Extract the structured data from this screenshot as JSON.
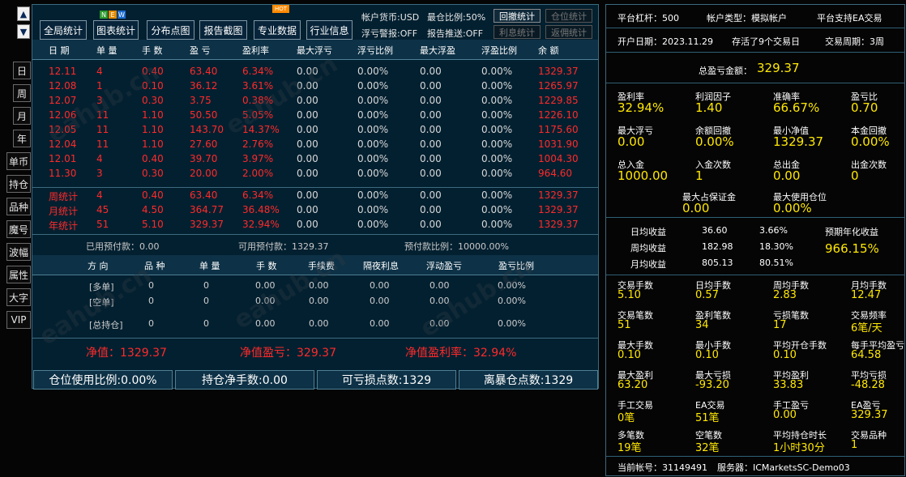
{
  "sidebar": {
    "up_glyph": "▲",
    "down_glyph": "▼",
    "items": [
      "日",
      "周",
      "月",
      "年",
      "单币",
      "持仓",
      "品种",
      "魔号",
      "波幅",
      "属性",
      "大字",
      "VIP"
    ]
  },
  "toolbar": {
    "buttons": [
      "全局统计",
      "图表统计",
      "分布点图",
      "报告截图",
      "专业数据",
      "行业信息"
    ],
    "new_badge": [
      "N",
      "E",
      "W"
    ],
    "hot_badge": "HOT",
    "info": {
      "currency": "帐户货币:USD",
      "max_ratio": "最仓比例:50%",
      "float_alert": "浮亏警报:OFF",
      "report_push": "报告推送:OFF"
    },
    "small_buttons": [
      "回撤统计",
      "仓位统计",
      "利息统计",
      "返佣统计"
    ]
  },
  "table": {
    "headers": [
      "日 期",
      "单 量",
      "手 数",
      "盈 亏",
      "盈利率",
      "最大浮亏",
      "浮亏比例",
      "最大浮盈",
      "浮盈比例",
      "余 额"
    ],
    "rows": [
      [
        "12.11",
        "4",
        "0.40",
        "63.40",
        "6.34%",
        "0.00",
        "0.00%",
        "0.00",
        "0.00%",
        "1329.37"
      ],
      [
        "12.08",
        "1",
        "0.10",
        "36.12",
        "3.61%",
        "0.00",
        "0.00%",
        "0.00",
        "0.00%",
        "1265.97"
      ],
      [
        "12.07",
        "3",
        "0.30",
        "3.75",
        "0.38%",
        "0.00",
        "0.00%",
        "0.00",
        "0.00%",
        "1229.85"
      ],
      [
        "12.06",
        "11",
        "1.10",
        "50.50",
        "5.05%",
        "0.00",
        "0.00%",
        "0.00",
        "0.00%",
        "1226.10"
      ],
      [
        "12.05",
        "11",
        "1.10",
        "143.70",
        "14.37%",
        "0.00",
        "0.00%",
        "0.00",
        "0.00%",
        "1175.60"
      ],
      [
        "12.04",
        "11",
        "1.10",
        "27.60",
        "2.76%",
        "0.00",
        "0.00%",
        "0.00",
        "0.00%",
        "1031.90"
      ],
      [
        "12.01",
        "4",
        "0.40",
        "39.70",
        "3.97%",
        "0.00",
        "0.00%",
        "0.00",
        "0.00%",
        "1004.30"
      ],
      [
        "11.30",
        "3",
        "0.30",
        "20.00",
        "2.00%",
        "0.00",
        "0.00%",
        "0.00",
        "0.00%",
        "964.60"
      ]
    ],
    "summary": [
      [
        "周统计",
        "4",
        "0.40",
        "63.40",
        "6.34%",
        "0.00",
        "0.00%",
        "0.00",
        "0.00%",
        "1329.37"
      ],
      [
        "月统计",
        "45",
        "4.50",
        "364.77",
        "36.48%",
        "0.00",
        "0.00%",
        "0.00",
        "0.00%",
        "1329.37"
      ],
      [
        "年统计",
        "51",
        "5.10",
        "329.37",
        "32.94%",
        "0.00",
        "0.00%",
        "0.00",
        "0.00%",
        "1329.37"
      ]
    ]
  },
  "prepay": {
    "used": "已用预付款：0.00",
    "available": "可用预付款：1329.37",
    "ratio": "预付款比例：10000.00%"
  },
  "positions": {
    "headers": [
      "方 向",
      "品 种",
      "单 量",
      "手 数",
      "手续费",
      "隔夜利息",
      "浮动盈亏",
      "盈亏比例"
    ],
    "rows": [
      [
        "[多单]",
        "0",
        "0",
        "0.00",
        "0.00",
        "0.00",
        "0.00",
        "0.00%"
      ],
      [
        "[空单]",
        "0",
        "0",
        "0.00",
        "0.00",
        "0.00",
        "0.00",
        "0.00%"
      ],
      [
        "[总持仓]",
        "0",
        "0",
        "0.00",
        "0.00",
        "0.00",
        "0.00",
        "0.00%"
      ]
    ]
  },
  "net": {
    "equity": "净值：1329.37",
    "equity_pnl": "净值盈亏：329.37",
    "equity_rate": "净值盈利率：32.94%"
  },
  "bottom_bar": [
    "仓位使用比例:0.00%",
    "持仓净手数:0.00",
    "可亏损点数:1329",
    "离暴仓点数:1329"
  ],
  "watermark": "eahub.cn",
  "right": {
    "leverage": "平台杠杆：500",
    "account_type": "帐户类型：模拟帐户",
    "ea_support": "平台支持EA交易",
    "open_date": "开户日期：2023.11.29",
    "survived": "存活了9个交易日",
    "cycle": "交易周期：3周",
    "total_pnl_label": "总盈亏金额：",
    "total_pnl_value": "329.37",
    "stats_a": [
      {
        "label": "盈利率",
        "value": "32.94%"
      },
      {
        "label": "利润因子",
        "value": "1.40"
      },
      {
        "label": "准确率",
        "value": "66.67%"
      },
      {
        "label": "盈亏比",
        "value": "0.70"
      },
      {
        "label": "最大浮亏",
        "value": "0.00"
      },
      {
        "label": "余额回撤",
        "value": "0.00%"
      },
      {
        "label": "最小净值",
        "value": "1329.37"
      },
      {
        "label": "本金回撤",
        "value": "0.00%"
      },
      {
        "label": "总入金",
        "value": "1000.00"
      },
      {
        "label": "入金次数",
        "value": "1"
      },
      {
        "label": "总出金",
        "value": "0.00"
      },
      {
        "label": "出金次数",
        "value": "0"
      }
    ],
    "margin": [
      {
        "label": "最大占保证金",
        "value": "0.00"
      },
      {
        "label": "最大使用仓位",
        "value": "0.00%"
      }
    ],
    "period": [
      {
        "label": "日均收益",
        "value": "36.60",
        "pct": "3.66%"
      },
      {
        "label": "周均收益",
        "value": "182.98",
        "pct": "18.30%"
      },
      {
        "label": "月均收益",
        "value": "805.13",
        "pct": "80.51%"
      }
    ],
    "annual_label": "预期年化收益",
    "annual_value": "966.15%",
    "stats_b": [
      {
        "label": "交易手数",
        "value": "5.10"
      },
      {
        "label": "日均手数",
        "value": "0.57"
      },
      {
        "label": "周均手数",
        "value": "2.83"
      },
      {
        "label": "月均手数",
        "value": "12.47"
      },
      {
        "label": "交易笔数",
        "value": "51"
      },
      {
        "label": "盈利笔数",
        "value": "34"
      },
      {
        "label": "亏损笔数",
        "value": "17"
      },
      {
        "label": "交易频率",
        "value": "6笔/天"
      },
      {
        "label": "最大手数",
        "value": "0.10"
      },
      {
        "label": "最小手数",
        "value": "0.10"
      },
      {
        "label": "平均开仓手数",
        "value": "0.10"
      },
      {
        "label": "每手平均盈亏",
        "value": "64.58"
      },
      {
        "label": "最大盈利",
        "value": "63.20"
      },
      {
        "label": "最大亏损",
        "value": "-93.20"
      },
      {
        "label": "平均盈利",
        "value": "33.83"
      },
      {
        "label": "平均亏损",
        "value": "-48.28"
      },
      {
        "label": "手工交易",
        "value": "0笔"
      },
      {
        "label": "EA交易",
        "value": "51笔"
      },
      {
        "label": "手工盈亏",
        "value": "0.00"
      },
      {
        "label": "EA盈亏",
        "value": "329.37"
      },
      {
        "label": "多笔数",
        "value": "19笔"
      },
      {
        "label": "空笔数",
        "value": "32笔"
      },
      {
        "label": "平均持仓时长",
        "value": "1小时30分"
      },
      {
        "label": "交易品种",
        "value": "1"
      }
    ],
    "account": "当前帐号：31149491",
    "server": "服务器：ICMarketsSC-Demo03"
  },
  "colors": {
    "accent_red": "#ff2a2a",
    "value_yellow": "#ffe800",
    "panel_bg": "#032030"
  }
}
